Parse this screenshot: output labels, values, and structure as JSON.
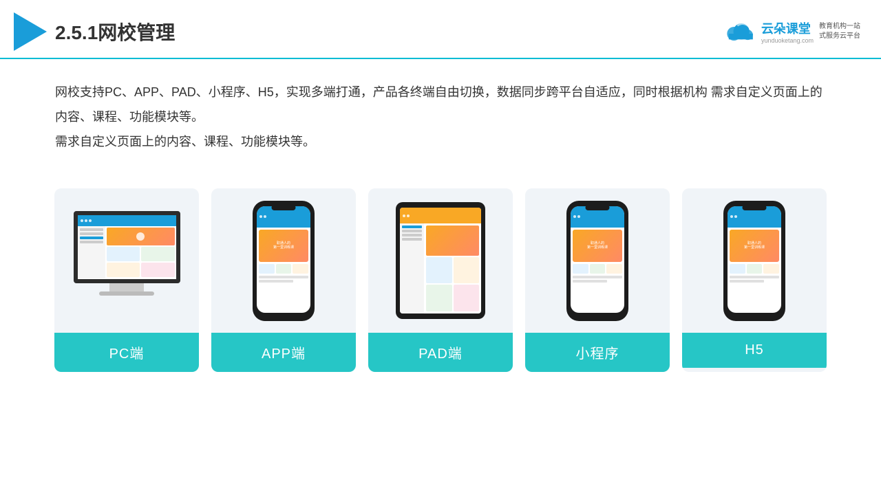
{
  "header": {
    "title": "2.5.1网校管理",
    "brand": {
      "name": "云朵课堂",
      "url": "yunduoketang.com",
      "slogan": "教育机构一站\n式服务云平台"
    }
  },
  "description": "网校支持PC、APP、PAD、小程序、H5，实现多端打通，产品各终端自由切换，数据同步跨平台自适应，同时根据机构\n需求自定义页面上的内容、课程、功能模块等。",
  "cards": [
    {
      "id": "pc",
      "label": "PC端",
      "device": "monitor"
    },
    {
      "id": "app",
      "label": "APP端",
      "device": "phone"
    },
    {
      "id": "pad",
      "label": "PAD端",
      "device": "tablet"
    },
    {
      "id": "miniprogram",
      "label": "小程序",
      "device": "phone"
    },
    {
      "id": "h5",
      "label": "H5",
      "device": "phone"
    }
  ],
  "accent_color": "#26c6c6",
  "title_color": "#333333"
}
